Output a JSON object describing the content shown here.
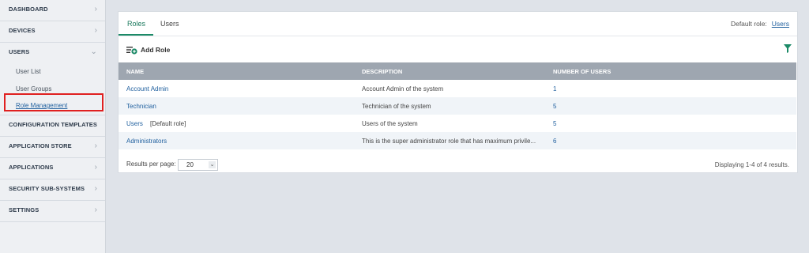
{
  "sidebar": {
    "items_top": [
      {
        "label": "DASHBOARD"
      },
      {
        "label": "DEVICES"
      }
    ],
    "users": {
      "label": "USERS",
      "sub_items": [
        {
          "label": "User List"
        },
        {
          "label": "User Groups"
        },
        {
          "label": "Role Management"
        }
      ]
    },
    "items_bottom": [
      {
        "label": "CONFIGURATION TEMPLATES"
      },
      {
        "label": "APPLICATION STORE"
      },
      {
        "label": "APPLICATIONS"
      },
      {
        "label": "SECURITY SUB-SYSTEMS"
      },
      {
        "label": "SETTINGS"
      }
    ]
  },
  "tabs": [
    {
      "label": "Roles"
    },
    {
      "label": "Users"
    }
  ],
  "default_role": {
    "label": "Default role:",
    "value": "Users"
  },
  "toolbar": {
    "add_role_label": "Add Role"
  },
  "table": {
    "headers": [
      "NAME",
      "DESCRIPTION",
      "NUMBER OF USERS"
    ],
    "rows": [
      {
        "name": "Account Admin",
        "tag": "",
        "description": "Account Admin of the system",
        "count": "1"
      },
      {
        "name": "Technician",
        "tag": "",
        "description": "Technician of the system",
        "count": "5"
      },
      {
        "name": "Users",
        "tag": "[Default role]",
        "description": "Users of the system",
        "count": "5"
      },
      {
        "name": "Administrators",
        "tag": "",
        "description": "This is the super administrator role that has maximum privile...",
        "count": "6"
      }
    ]
  },
  "footer": {
    "results_per_page_label": "Results per page:",
    "results_per_page_value": "20",
    "display_text": "Displaying 1-4 of 4 results."
  },
  "colors": {
    "accent": "#1c8a67",
    "link": "#1f5f9e",
    "highlight": "#e02020"
  }
}
